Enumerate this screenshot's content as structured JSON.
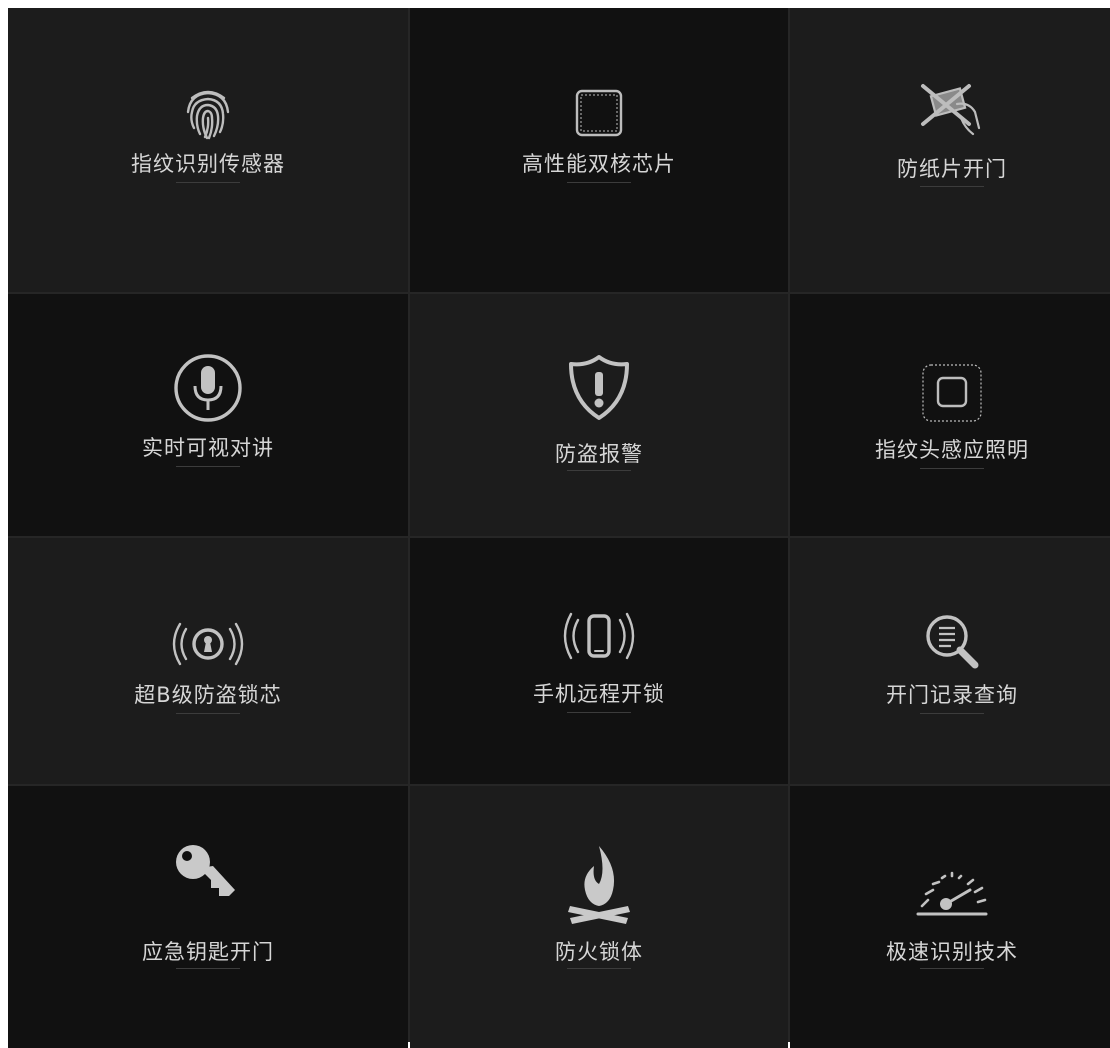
{
  "features": [
    {
      "label": "指纹识别传感器",
      "icon": "fingerprint-icon"
    },
    {
      "label": "高性能双核芯片",
      "icon": "chip-icon"
    },
    {
      "label": "防纸片开门",
      "icon": "no-paper-card-icon"
    },
    {
      "label": "实时可视对讲",
      "icon": "microphone-icon"
    },
    {
      "label": "防盗报警",
      "icon": "shield-alert-icon"
    },
    {
      "label": "指纹头感应照明",
      "icon": "sensor-light-icon"
    },
    {
      "label": "超B级防盗锁芯",
      "icon": "lock-cylinder-signal-icon"
    },
    {
      "label": "手机远程开锁",
      "icon": "phone-signal-icon"
    },
    {
      "label": "开门记录查询",
      "icon": "record-search-icon"
    },
    {
      "label": "应急钥匙开门",
      "icon": "key-icon"
    },
    {
      "label": "防火锁体",
      "icon": "fire-icon"
    },
    {
      "label": "极速识别技术",
      "icon": "speedometer-icon"
    }
  ]
}
